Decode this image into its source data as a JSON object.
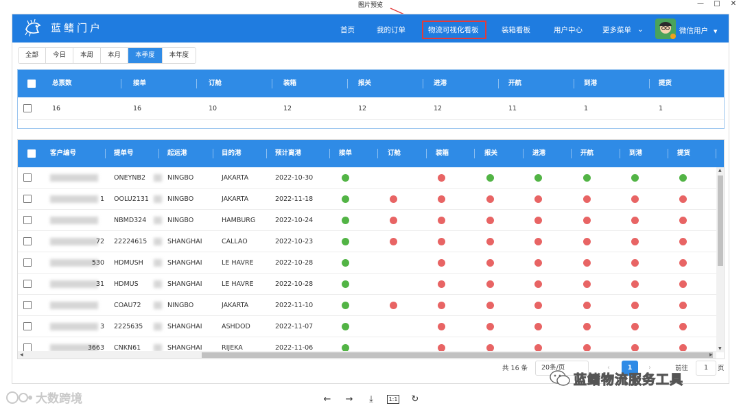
{
  "viewer": {
    "title": "图片预览",
    "window_controls": [
      "—",
      "□",
      "✕"
    ],
    "tools": [
      "←",
      "→",
      "⤓",
      "1:1",
      "↻"
    ]
  },
  "app": {
    "brand": "蓝鳍门户",
    "nav": [
      "首页",
      "我的订单",
      "物流可视化看板",
      "装箱看板",
      "用户中心",
      "更多菜单"
    ],
    "more_caret": "⌄",
    "user_name": "微信用户",
    "user_caret": "▼",
    "accent": "#1f7ce0",
    "highlight": "#e23b3b"
  },
  "filters": {
    "items": [
      "全部",
      "今日",
      "本周",
      "本月",
      "本季度",
      "本年度"
    ],
    "active": "本季度"
  },
  "summary": {
    "headers": [
      "总票数",
      "接单",
      "订舱",
      "装箱",
      "报关",
      "进港",
      "开航",
      "到港",
      "提货"
    ],
    "values": [
      "16",
      "16",
      "10",
      "12",
      "12",
      "12",
      "11",
      "1",
      "1"
    ]
  },
  "orders": {
    "headers": [
      "客户编号",
      "提单号",
      "起运港",
      "目的港",
      "预计离港",
      "接单",
      "订舱",
      "装箱",
      "报关",
      "进港",
      "开航",
      "到港",
      "提货"
    ],
    "status_colors": {
      "g": "#52b445",
      "r": "#e86464"
    },
    "rows": [
      {
        "cust": "",
        "bl": "ONEYNB2",
        "pol": "NINGBO",
        "pod": "JAKARTA",
        "etd": "2022-10-30",
        "st": [
          "g",
          "",
          "r",
          "g",
          "g",
          "g",
          "g",
          "g"
        ]
      },
      {
        "cust": "1",
        "bl": "OOLU2131",
        "pol": "NINGBO",
        "pod": "JAKARTA",
        "etd": "2022-11-18",
        "st": [
          "g",
          "r",
          "r",
          "r",
          "r",
          "r",
          "r",
          "r"
        ]
      },
      {
        "cust": "",
        "bl": "NBMD324",
        "pol": "NINGBO",
        "pod": "HAMBURG",
        "etd": "2022-10-24",
        "st": [
          "g",
          "r",
          "r",
          "r",
          "r",
          "r",
          "r",
          "r"
        ]
      },
      {
        "cust": "72",
        "bl": "22224615",
        "pol": "SHANGHAI",
        "pod": "CALLAO",
        "etd": "2022-10-23",
        "st": [
          "g",
          "r",
          "r",
          "r",
          "r",
          "r",
          "r",
          "r"
        ]
      },
      {
        "cust": "530",
        "bl": "HDMUSH",
        "pol": "SHANGHAI",
        "pod": "LE HAVRE",
        "etd": "2022-10-28",
        "st": [
          "g",
          "",
          "r",
          "r",
          "r",
          "r",
          "r",
          "r"
        ]
      },
      {
        "cust": "31",
        "bl": "HDMUS",
        "pol": "SHANGHAI",
        "pod": "LE HAVRE",
        "etd": "2022-10-28",
        "st": [
          "g",
          "",
          "r",
          "r",
          "r",
          "r",
          "r",
          "r"
        ]
      },
      {
        "cust": "",
        "bl": "COAU72",
        "pol": "NINGBO",
        "pod": "JAKARTA",
        "etd": "2022-11-10",
        "st": [
          "g",
          "r",
          "r",
          "r",
          "r",
          "r",
          "r",
          "r"
        ]
      },
      {
        "cust": "3",
        "bl": "2225635",
        "pol": "SHANGHAI",
        "pod": "ASHDOD",
        "etd": "2022-11-07",
        "st": [
          "g",
          "",
          "r",
          "r",
          "r",
          "r",
          "r",
          "r"
        ]
      },
      {
        "cust": "3663",
        "bl": "CNKN61",
        "pol": "SHANGHAI",
        "pod": "RIJEKA",
        "etd": "2022-11-06",
        "st": [
          "g",
          "",
          "r",
          "r",
          "r",
          "r",
          "r",
          "r"
        ]
      }
    ]
  },
  "pager": {
    "total": "共 16 条",
    "page_size": "20条/页",
    "prev": "‹",
    "current": "1",
    "next": "›",
    "goto_label": "前往",
    "goto_value": "1",
    "unit": "页"
  },
  "watermarks": {
    "left": "大数跨境",
    "right": "蓝鳍物流服务工具"
  }
}
